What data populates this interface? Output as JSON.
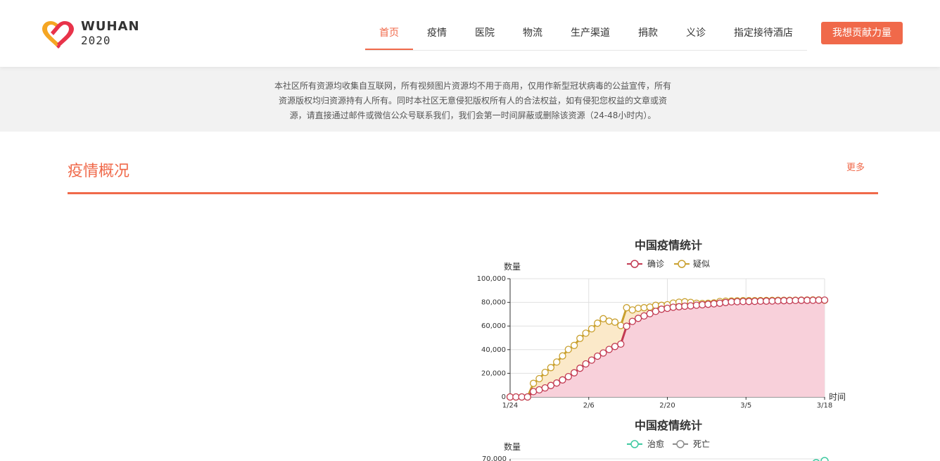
{
  "brand": {
    "name": "WUHAN",
    "year": "2020",
    "colors": {
      "accent": "#f0694a",
      "logo_orange": "#f5a623",
      "logo_red": "#e8334a"
    }
  },
  "nav": {
    "items": [
      {
        "label": "首页",
        "active": true
      },
      {
        "label": "疫情",
        "active": false
      },
      {
        "label": "医院",
        "active": false
      },
      {
        "label": "物流",
        "active": false
      },
      {
        "label": "生产渠道",
        "active": false
      },
      {
        "label": "捐款",
        "active": false
      },
      {
        "label": "义诊",
        "active": false
      },
      {
        "label": "指定接待酒店",
        "active": false
      }
    ],
    "cta_label": "我想贡献力量"
  },
  "notice": {
    "lines": [
      "本社区所有资源均收集自互联网，所有视频图片资源均不用于商用，仅用作新型冠状病毒的公益宣传，所有",
      "资源版权均归资源持有人所有。同时本社区无意侵犯版权所有人的合法权益，如有侵犯您权益的文章或资",
      "源，请直接通过邮件或微信公众号联系我们，我们会第一时间屏蔽或删除该资源（24-48小时内）。"
    ]
  },
  "section": {
    "title": "疫情概况",
    "more_label": "更多"
  },
  "chart_data": [
    {
      "type": "area",
      "title": "中国疫情统计",
      "xlabel": "时间",
      "ylabel": "数量",
      "x_ticks": [
        "1/24",
        "2/6",
        "2/20",
        "3/5",
        "3/18"
      ],
      "y_ticks": [
        "0",
        "20,000",
        "40,000",
        "60,000",
        "80,000",
        "100,000"
      ],
      "ylim": [
        0,
        100000
      ],
      "grid": true,
      "legend_position": "top-center",
      "x_start": "1/24",
      "x_end": "3/18",
      "series": [
        {
          "name": "确诊",
          "color": "#c23a52",
          "fill": "#f8d0da",
          "values": [
            0,
            0,
            0,
            0,
            4500,
            6000,
            7700,
            9700,
            11800,
            14400,
            17200,
            20400,
            24300,
            28000,
            31200,
            34500,
            37200,
            40200,
            42700,
            44700,
            59800,
            63900,
            66500,
            68500,
            70500,
            72400,
            74200,
            75000,
            75900,
            76300,
            76800,
            77100,
            77600,
            78000,
            78400,
            78800,
            79300,
            79900,
            80400,
            80600,
            80700,
            80800,
            80900,
            81000,
            81100,
            81200,
            81300,
            81400,
            81500,
            81600,
            81700,
            81750,
            81800,
            81850,
            81900
          ]
        },
        {
          "name": "疑似",
          "color": "#c9a02e",
          "fill": "#fbe9c9",
          "values": [
            0,
            0,
            0,
            0,
            11500,
            15500,
            20800,
            24800,
            29500,
            34700,
            40200,
            43600,
            49500,
            53900,
            57700,
            62400,
            66200,
            64100,
            63300,
            60400,
            75500,
            73600,
            75000,
            75500,
            76000,
            77500,
            77500,
            78000,
            79400,
            80100,
            80500,
            80000,
            79200,
            79000,
            79200,
            79500,
            80700,
            81000,
            81200,
            81300,
            81400,
            81450,
            81500,
            81550,
            81600,
            81650,
            81700,
            81750,
            81800,
            81850,
            81900,
            81950,
            82000,
            82000,
            81800
          ]
        }
      ]
    },
    {
      "type": "line",
      "title": "中国疫情统计",
      "ylabel": "数量",
      "y_ticks_visible": [
        "70,000"
      ],
      "legend_position": "top-center",
      "series": [
        {
          "name": "治愈",
          "color": "#3ec9a0"
        },
        {
          "name": "死亡",
          "color": "#8c8c8c"
        }
      ]
    }
  ]
}
